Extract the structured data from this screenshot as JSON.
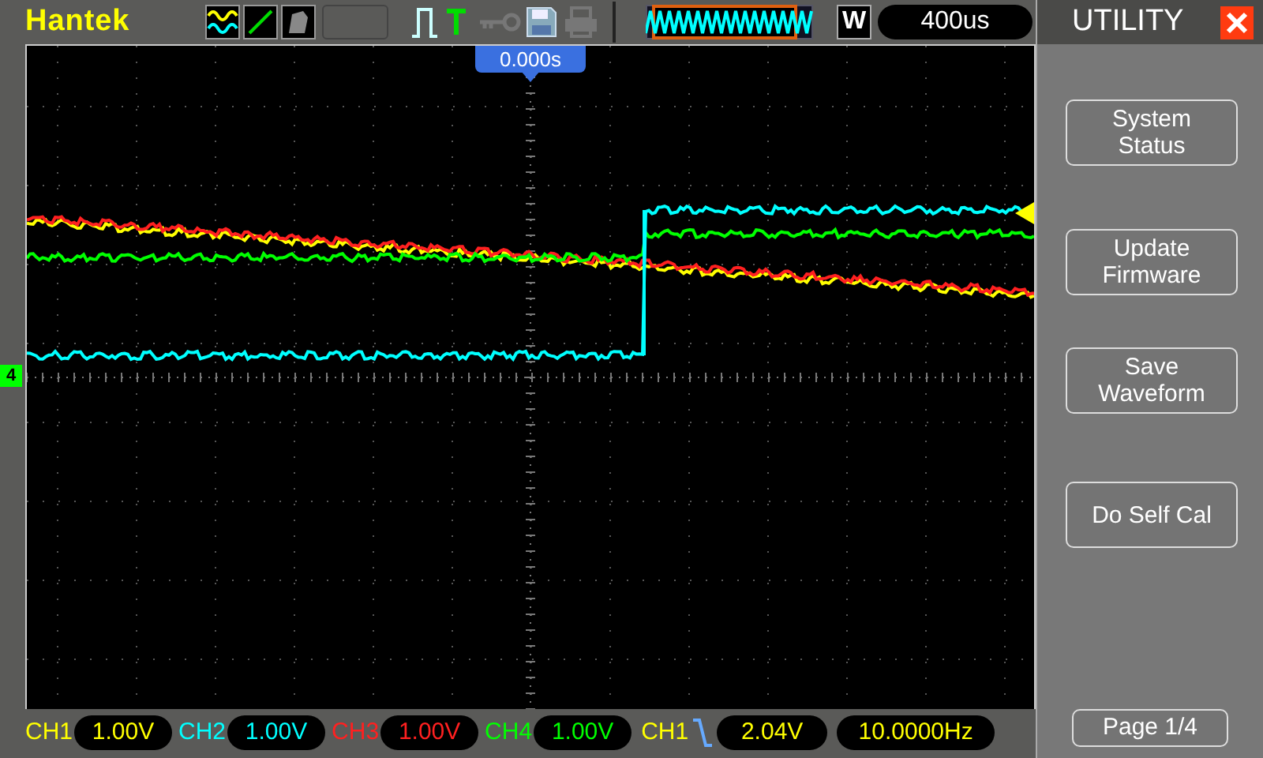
{
  "header": {
    "brand": "Hantek",
    "timebase_mode": "W",
    "timebase": "400us"
  },
  "display": {
    "time_offset": "0.000s",
    "channel_marker": "4"
  },
  "menu": {
    "title": "UTILITY",
    "buttons": [
      "System\nStatus",
      "Update\nFirmware",
      "Save\nWaveform",
      "Do Self Cal"
    ],
    "page": "Page 1/4"
  },
  "channels": [
    {
      "label": "CH1",
      "value": "1.00V",
      "color": "#ffff00"
    },
    {
      "label": "CH2",
      "value": "1.00V",
      "color": "#00ffff"
    },
    {
      "label": "CH3",
      "value": "1.00V",
      "color": "#ff2020"
    },
    {
      "label": "CH4",
      "value": "1.00V",
      "color": "#00ff00"
    }
  ],
  "trigger": {
    "source": "CH1",
    "level": "2.04V",
    "frequency": "10.0000Hz"
  }
}
